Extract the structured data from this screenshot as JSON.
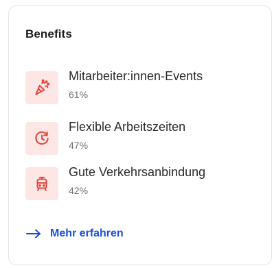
{
  "card": {
    "title": "Benefits",
    "items": [
      {
        "icon": "party-popper-icon",
        "label": "Mitarbeiter:innen-Events",
        "percent": "61%"
      },
      {
        "icon": "clock-refresh-icon",
        "label": "Flexible Arbeitszeiten",
        "percent": "47%"
      },
      {
        "icon": "tram-icon",
        "label": "Gute Verkehrsanbindung",
        "percent": "42%"
      }
    ],
    "more_link": "Mehr erfahren"
  },
  "colors": {
    "icon_accent": "#e2453b",
    "icon_background": "#fde6e6",
    "link": "#1a4fd6",
    "border": "#e3e5e8"
  }
}
